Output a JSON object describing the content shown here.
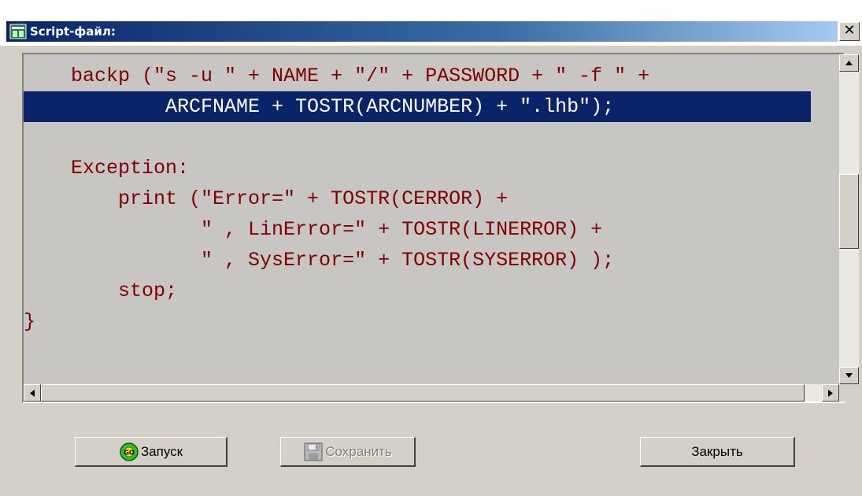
{
  "window": {
    "title": "Script-файл:",
    "close_label": "✕"
  },
  "editor": {
    "lines": [
      {
        "text": "    backp (\"s -u \" + NAME + \"/\" + PASSWORD + \" -f \" +",
        "selected": false
      },
      {
        "text": "            ARCFNAME + TOSTR(ARCNUMBER) + \".lhb\");",
        "selected": true
      },
      {
        "text": "",
        "selected": false
      },
      {
        "text": "    Exception:",
        "selected": false
      },
      {
        "text": "        print (\"Error=\" + TOSTR(CERROR) +",
        "selected": false
      },
      {
        "text": "               \" , LinError=\" + TOSTR(LINERROR) +",
        "selected": false
      },
      {
        "text": "               \" , SysError=\" + TOSTR(SYSERROR) );",
        "selected": false
      },
      {
        "text": "        stop;",
        "selected": false
      },
      {
        "text": "}",
        "selected": false
      }
    ]
  },
  "buttons": {
    "run_label": "Запуск",
    "run_icon": "go-icon",
    "save_label": "Сохранить",
    "save_icon": "floppy-disk-icon",
    "save_enabled": false,
    "close_label": "Закрыть"
  },
  "colors": {
    "code_text": "#800000",
    "code_background": "#c8c6c2",
    "selection_background": "#0a246a",
    "titlebar_start": "#0a246a",
    "titlebar_end": "#a6caf0"
  }
}
